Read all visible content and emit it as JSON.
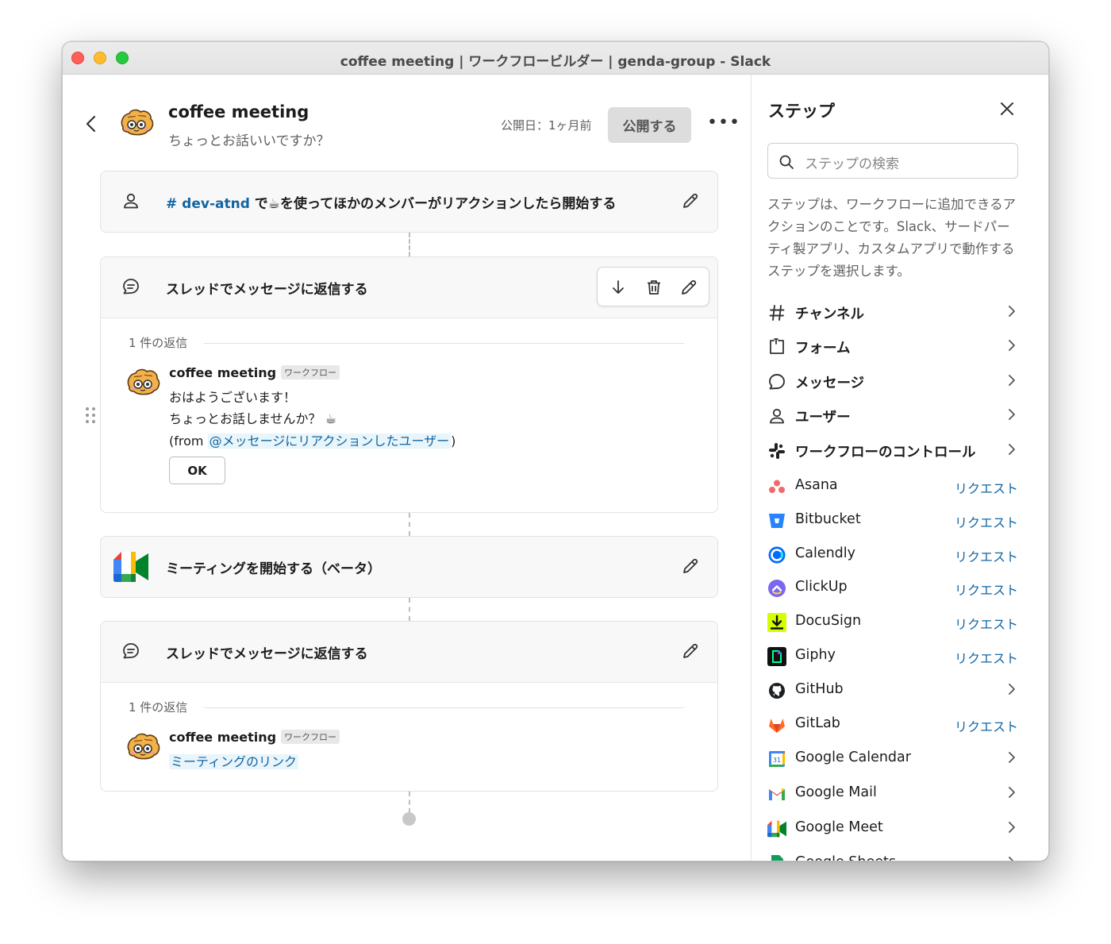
{
  "window": {
    "title": "coffee meeting | ワークフロービルダー | genda-group - Slack"
  },
  "header": {
    "title": "coffee meeting",
    "subtitle": "ちょっとお話いいですか？",
    "published": "公開日：1ヶ月前",
    "publish_button": "公開する",
    "more": "•••"
  },
  "trigger": {
    "channel": "# dev-atnd",
    "text": "で☕を使ってほかのメンバーがリアクションしたら開始する"
  },
  "step1": {
    "title": "スレッドでメッセージに返信する",
    "reply_count": "1 件の返信",
    "sender": "coffee meeting",
    "tag": "ワークフロー",
    "line1": "おはようございます！",
    "line2": "ちょっとお話しませんか？ ☕",
    "from_prefix": "(from ",
    "mention": "@メッセージにリアクションしたユーザー",
    "from_suffix": ")",
    "button": "OK"
  },
  "step2": {
    "title": "ミーティングを開始する（ベータ）"
  },
  "step3": {
    "title": "スレッドでメッセージに返信する",
    "reply_count": "1 件の返信",
    "sender": "coffee meeting",
    "tag": "ワークフロー",
    "link": "ミーティングのリンク"
  },
  "sidebar": {
    "title": "ステップ",
    "search_placeholder": "ステップの検索",
    "description": "ステップは、ワークフローに追加できるアクションのことです。Slack、サードパーティ製アプリ、カスタムアプリで動作するステップを選択します。",
    "categories": [
      {
        "label": "チャンネル",
        "icon": "hash-icon"
      },
      {
        "label": "フォーム",
        "icon": "form-icon"
      },
      {
        "label": "メッセージ",
        "icon": "message-icon"
      },
      {
        "label": "ユーザー",
        "icon": "user-icon"
      },
      {
        "label": "ワークフローのコントロール",
        "icon": "slack-icon"
      }
    ],
    "apps": [
      {
        "label": "Asana",
        "action": "リクエスト"
      },
      {
        "label": "Bitbucket",
        "action": "リクエスト"
      },
      {
        "label": "Calendly",
        "action": "リクエスト"
      },
      {
        "label": "ClickUp",
        "action": "リクエスト"
      },
      {
        "label": "DocuSign",
        "action": "リクエスト"
      },
      {
        "label": "Giphy",
        "action": "リクエスト"
      },
      {
        "label": "GitHub",
        "action": ""
      },
      {
        "label": "GitLab",
        "action": "リクエスト"
      },
      {
        "label": "Google Calendar",
        "action": ""
      },
      {
        "label": "Google Mail",
        "action": ""
      },
      {
        "label": "Google Meet",
        "action": ""
      },
      {
        "label": "Google Sheets",
        "action": ""
      }
    ]
  }
}
